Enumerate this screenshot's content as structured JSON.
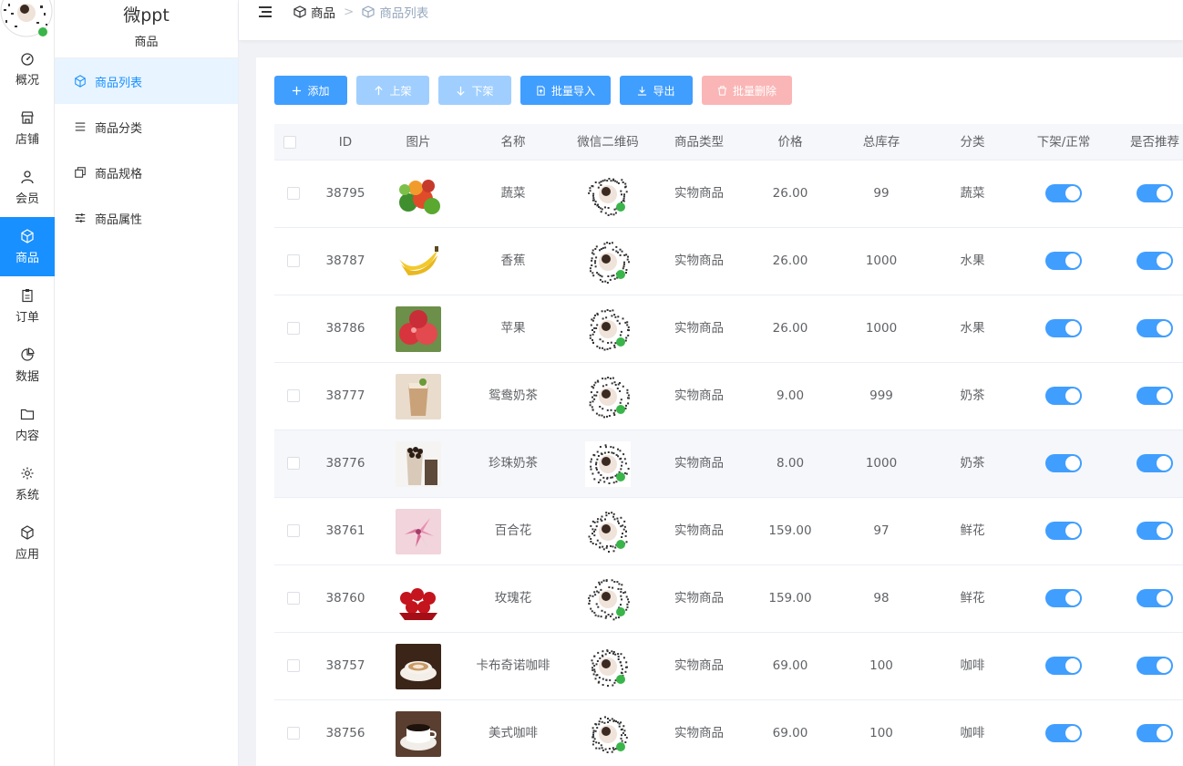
{
  "app": {
    "name": "微ppt",
    "section": "商品"
  },
  "colors": {
    "primary": "#409eff",
    "active_nav": "#1890ff",
    "danger_disabled": "#fab6b6",
    "primary_disabled": "#a0cfff"
  },
  "rail": [
    {
      "label": "概况",
      "icon": "dashboard-icon",
      "active": false
    },
    {
      "label": "店铺",
      "icon": "shop-icon",
      "active": false
    },
    {
      "label": "会员",
      "icon": "user-icon",
      "active": false
    },
    {
      "label": "商品",
      "icon": "box-icon",
      "active": true
    },
    {
      "label": "订单",
      "icon": "clipboard-icon",
      "active": false
    },
    {
      "label": "数据",
      "icon": "pie-chart-icon",
      "active": false
    },
    {
      "label": "内容",
      "icon": "folder-icon",
      "active": false
    },
    {
      "label": "系统",
      "icon": "gear-icon",
      "active": false
    },
    {
      "label": "应用",
      "icon": "box-icon",
      "active": false
    }
  ],
  "submenu": [
    {
      "label": "商品列表",
      "icon": "box-icon",
      "active": true
    },
    {
      "label": "商品分类",
      "icon": "list-icon",
      "active": false
    },
    {
      "label": "商品规格",
      "icon": "copy-icon",
      "active": false
    },
    {
      "label": "商品属性",
      "icon": "sliders-icon",
      "active": false
    }
  ],
  "breadcrumb": {
    "level1": "商品",
    "separator": ">",
    "level2": "商品列表"
  },
  "toolbar": {
    "add": "添加",
    "on_shelf": "上架",
    "off_shelf": "下架",
    "batch_import": "批量导入",
    "export": "导出",
    "batch_delete": "批量删除"
  },
  "table": {
    "headers": {
      "id": "ID",
      "image": "图片",
      "name": "名称",
      "qrcode": "微信二维码",
      "type": "商品类型",
      "price": "价格",
      "stock": "总库存",
      "category": "分类",
      "status": "下架/正常",
      "recommend": "是否推荐"
    },
    "rows": [
      {
        "id": "38795",
        "image": "vegetables",
        "name": "蔬菜",
        "type": "实物商品",
        "price": "26.00",
        "stock": "99",
        "category": "蔬菜",
        "status_on": true,
        "recommend_on": true
      },
      {
        "id": "38787",
        "image": "bananas",
        "name": "香蕉",
        "type": "实物商品",
        "price": "26.00",
        "stock": "1000",
        "category": "水果",
        "status_on": true,
        "recommend_on": true
      },
      {
        "id": "38786",
        "image": "apples",
        "name": "苹果",
        "type": "实物商品",
        "price": "26.00",
        "stock": "1000",
        "category": "水果",
        "status_on": true,
        "recommend_on": true
      },
      {
        "id": "38777",
        "image": "milk-tea",
        "name": "鸳鸯奶茶",
        "type": "实物商品",
        "price": "9.00",
        "stock": "999",
        "category": "奶茶",
        "status_on": true,
        "recommend_on": true
      },
      {
        "id": "38776",
        "image": "bubble-tea",
        "name": "珍珠奶茶",
        "type": "实物商品",
        "price": "8.00",
        "stock": "1000",
        "category": "奶茶",
        "status_on": true,
        "recommend_on": true
      },
      {
        "id": "38761",
        "image": "lily",
        "name": "百合花",
        "type": "实物商品",
        "price": "159.00",
        "stock": "97",
        "category": "鲜花",
        "status_on": true,
        "recommend_on": true
      },
      {
        "id": "38760",
        "image": "roses",
        "name": "玫瑰花",
        "type": "实物商品",
        "price": "159.00",
        "stock": "98",
        "category": "鲜花",
        "status_on": true,
        "recommend_on": true
      },
      {
        "id": "38757",
        "image": "cappuccino",
        "name": "卡布奇诺咖啡",
        "type": "实物商品",
        "price": "69.00",
        "stock": "100",
        "category": "咖啡",
        "status_on": true,
        "recommend_on": true
      },
      {
        "id": "38756",
        "image": "americano",
        "name": "美式咖啡",
        "type": "实物商品",
        "price": "69.00",
        "stock": "100",
        "category": "咖啡",
        "status_on": true,
        "recommend_on": true
      }
    ]
  }
}
